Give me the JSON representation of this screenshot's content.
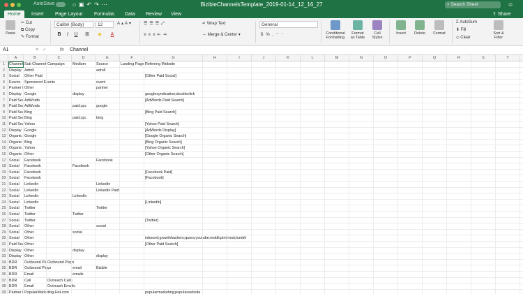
{
  "window": {
    "title": "BizibleChannelsTemplate_2019-01-14_12_16_27",
    "autosave_label": "AutoSave",
    "search_placeholder": "Search Sheet"
  },
  "tabs": [
    "Home",
    "Insert",
    "Page Layout",
    "Formulas",
    "Data",
    "Review",
    "View"
  ],
  "active_tab": "Home",
  "share_label": "Share",
  "ribbon": {
    "paste_label": "Paste",
    "cut_label": "Cut",
    "copy_label": "Copy",
    "format_label": "Format",
    "font_name": "Calibri (Body)",
    "font_size": "12",
    "bold": "B",
    "italic": "I",
    "underline": "U",
    "font_color_glyph": "A",
    "wrap_text": "Wrap Text",
    "merge_center": "Merge & Center",
    "number_format": "General",
    "currency": "$",
    "percent": "%",
    "conditional_formatting": [
      "Conditional",
      "Formatting"
    ],
    "format_as_table": [
      "Format",
      "as Table"
    ],
    "cell_styles": [
      "Cell",
      "Styles"
    ],
    "insert": "Insert",
    "delete": "Delete",
    "format": "Format",
    "autosum": "AutoSum",
    "fill": "Fill",
    "clear": "Clear",
    "sort_filter": [
      "Sort &",
      "Filter"
    ]
  },
  "formula_bar": {
    "name_box": "A1",
    "fx": "fx",
    "content": "Channel"
  },
  "columns": [
    "A",
    "B",
    "C",
    "D",
    "E",
    "F",
    "G",
    "H",
    "I",
    "J",
    "K",
    "L",
    "M",
    "N",
    "O",
    "P",
    "Q",
    "R",
    "S",
    "T",
    "U"
  ],
  "rows": [
    {
      "n": "1",
      "A": "Channel",
      "B": "Sub Channel",
      "C": "Campaign",
      "D": "Medium",
      "E": "Source",
      "F": "Landing Page",
      "G": "Referring Website"
    },
    {
      "n": "2",
      "A": "Display",
      "B": "Adroll",
      "C": "",
      "D": "",
      "E": "adroll",
      "F": "",
      "G": ""
    },
    {
      "n": "3",
      "A": "Social",
      "B": "Other Paid",
      "C": "",
      "D": "",
      "E": "",
      "F": "",
      "G": "[Other Paid Social]"
    },
    {
      "n": "4",
      "A": "Events",
      "B": "Sponsored Events",
      "C": "",
      "D": "",
      "E": "event",
      "F": "",
      "G": ""
    },
    {
      "n": "5",
      "A": "Partner Marketing",
      "B": "Other",
      "C": "",
      "D": "",
      "E": "partner",
      "F": "",
      "G": ""
    },
    {
      "n": "6",
      "A": "Display",
      "B": "Google",
      "C": "",
      "D": "display",
      "E": "",
      "F": "",
      "G": "googlesyndication;doubleclick"
    },
    {
      "n": "7",
      "A": "Paid Search",
      "B": "AdWords",
      "C": "",
      "D": "",
      "E": "",
      "F": "",
      "G": "[AdWords Paid Search]"
    },
    {
      "n": "8",
      "A": "Paid Search",
      "B": "AdWords",
      "C": "",
      "D": "paid;cpc",
      "E": "google",
      "F": "",
      "G": ""
    },
    {
      "n": "9",
      "A": "Paid Search",
      "B": "Bing",
      "C": "",
      "D": "",
      "E": "",
      "F": "",
      "G": "[Bing Paid Search]"
    },
    {
      "n": "10",
      "A": "Paid Search",
      "B": "Bing",
      "C": "",
      "D": "paid;cpc",
      "E": "bing",
      "F": "",
      "G": ""
    },
    {
      "n": "11",
      "A": "Paid Search",
      "B": "Yahoo",
      "C": "",
      "D": "",
      "E": "",
      "F": "",
      "G": "[Yahoo Paid Search]"
    },
    {
      "n": "12",
      "A": "Display",
      "B": "Google",
      "C": "",
      "D": "",
      "E": "",
      "F": "",
      "G": "[AdWords Display]"
    },
    {
      "n": "13",
      "A": "Organic Search",
      "B": "Google",
      "C": "",
      "D": "",
      "E": "",
      "F": "",
      "G": "[Google Organic Search]"
    },
    {
      "n": "14",
      "A": "Organic Search",
      "B": "Bing",
      "C": "",
      "D": "",
      "E": "",
      "F": "",
      "G": "[Bing Organic Search]"
    },
    {
      "n": "15",
      "A": "Organic Search",
      "B": "Yahoo",
      "C": "",
      "D": "",
      "E": "",
      "F": "",
      "G": "[Yahoo Organic Search]"
    },
    {
      "n": "16",
      "A": "Organic Search",
      "B": "Other",
      "C": "",
      "D": "",
      "E": "",
      "F": "",
      "G": "[Other Organic Search]"
    },
    {
      "n": "17",
      "A": "Social",
      "B": "Facebook",
      "C": "",
      "D": "",
      "E": "Facebook",
      "F": "",
      "G": ""
    },
    {
      "n": "18",
      "A": "Social",
      "B": "Facebook",
      "C": "",
      "D": "Facebook",
      "E": "",
      "F": "",
      "G": ""
    },
    {
      "n": "19",
      "A": "Social",
      "B": "Facebook",
      "C": "",
      "D": "",
      "E": "",
      "F": "",
      "G": "[Facebook Paid]"
    },
    {
      "n": "20",
      "A": "Social",
      "B": "Facebook",
      "C": "",
      "D": "",
      "E": "",
      "F": "",
      "G": "[Facebook]"
    },
    {
      "n": "21",
      "A": "Social",
      "B": "LinkedIn",
      "C": "",
      "D": "",
      "E": "LinkedIn",
      "F": "",
      "G": ""
    },
    {
      "n": "22",
      "A": "Social",
      "B": "LinkedIn",
      "C": "",
      "D": "",
      "E": "LinkedIn Paid",
      "F": "",
      "G": ""
    },
    {
      "n": "23",
      "A": "Social",
      "B": "LinkedIn",
      "C": "",
      "D": "LinkedIn",
      "E": "",
      "F": "",
      "G": ""
    },
    {
      "n": "24",
      "A": "Social",
      "B": "LinkedIn",
      "C": "",
      "D": "",
      "E": "",
      "F": "",
      "G": "[LinkedIn]"
    },
    {
      "n": "25",
      "A": "Social",
      "B": "Twitter",
      "C": "",
      "D": "",
      "E": "Twitter",
      "F": "",
      "G": ""
    },
    {
      "n": "26",
      "A": "Social",
      "B": "Twitter",
      "C": "",
      "D": "Twitter",
      "E": "",
      "F": "",
      "G": ""
    },
    {
      "n": "27",
      "A": "Social",
      "B": "Twitter",
      "C": "",
      "D": "",
      "E": "",
      "F": "",
      "G": "[Twitter]"
    },
    {
      "n": "28",
      "A": "Social",
      "B": "Other",
      "C": "",
      "D": "",
      "E": "social",
      "F": "",
      "G": ""
    },
    {
      "n": "29",
      "A": "Social",
      "B": "Other",
      "C": "",
      "D": "social",
      "E": "",
      "F": "",
      "G": ""
    },
    {
      "n": "30",
      "A": "Social",
      "B": "Other",
      "C": "",
      "D": "",
      "E": "",
      "F": "",
      "G": "inbound;growthhackers;quora;youtube;reddit;pinterest;tumblr"
    },
    {
      "n": "31",
      "A": "Paid Search",
      "B": "Other",
      "C": "",
      "D": "",
      "E": "",
      "F": "",
      "G": "[Other Paid Search]"
    },
    {
      "n": "32",
      "A": "Display",
      "B": "Other",
      "C": "",
      "D": "display",
      "E": "",
      "F": "",
      "G": ""
    },
    {
      "n": "33",
      "A": "Display",
      "B": "Other",
      "C": "",
      "D": "",
      "E": "display",
      "F": "",
      "G": ""
    },
    {
      "n": "34",
      "A": "BDR",
      "B": "Outbound Plays",
      "C": "Outbound Plays",
      "D": "",
      "E": "",
      "F": "",
      "G": ""
    },
    {
      "n": "35",
      "A": "BDR",
      "B": "Outbound Plays",
      "C": "",
      "D": "email",
      "E": "Bizible",
      "F": "",
      "G": ""
    },
    {
      "n": "36",
      "A": "BDR",
      "B": "Email",
      "C": "",
      "D": "emails",
      "E": "",
      "F": "",
      "G": ""
    },
    {
      "n": "37",
      "A": "BDR",
      "B": "Call",
      "C": "Outreach Calls",
      "D": "",
      "E": "",
      "F": "",
      "G": ""
    },
    {
      "n": "38",
      "A": "BDR",
      "B": "Email",
      "C": "Outreach Emails",
      "D": "",
      "E": "",
      "F": "",
      "G": ""
    },
    {
      "n": "39",
      "A": "Partner Marketing",
      "B": "PopularMarketing.Hot.com",
      "C": "",
      "D": "",
      "E": "",
      "F": "",
      "G": "popularmarketing;popularwebsite"
    }
  ],
  "colors": {
    "excel_green": "#1f7244",
    "ribbon_bg": "#f3f3f3",
    "header_bg": "#f4f4f4"
  }
}
